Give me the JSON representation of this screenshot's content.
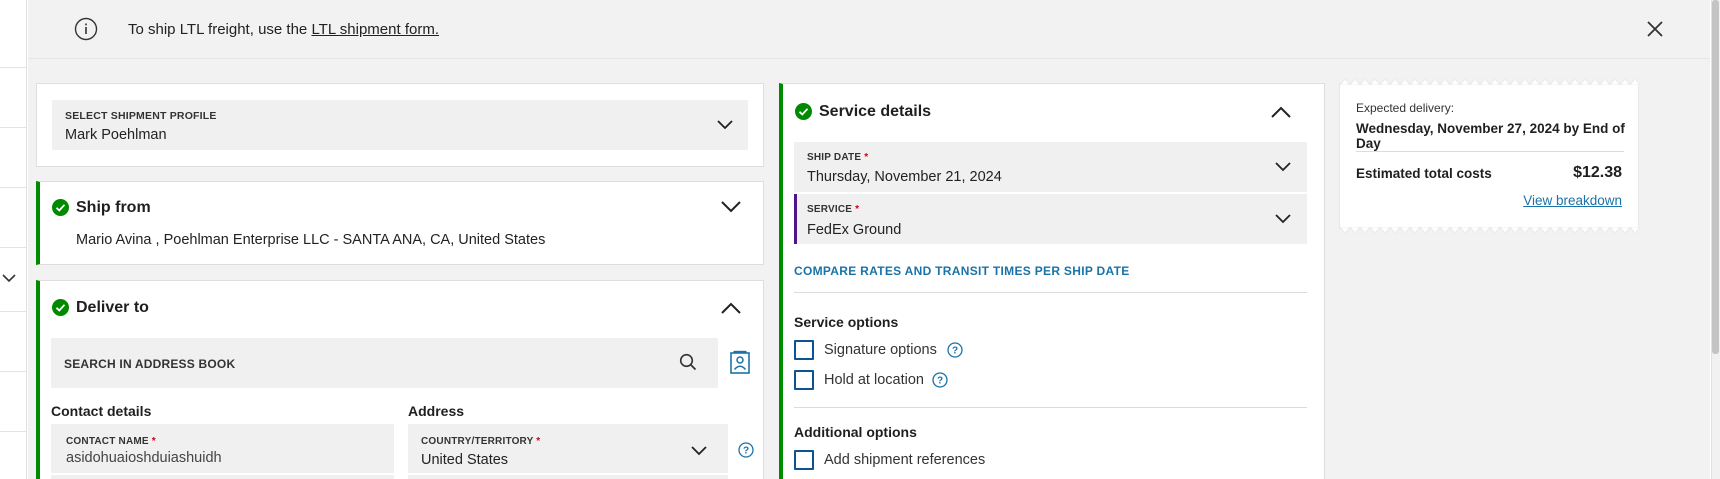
{
  "banner": {
    "message_prefix": "To ship LTL freight, use the ",
    "link_text": "LTL shipment form."
  },
  "profile": {
    "label": "SELECT SHIPMENT PROFILE",
    "value": "Mark Poehlman"
  },
  "ship_from": {
    "title": "Ship from",
    "address": "Mario Avina , Poehlman Enterprise LLC - SANTA ANA, CA, United States"
  },
  "deliver_to": {
    "title": "Deliver to",
    "search_placeholder": "SEARCH IN ADDRESS BOOK",
    "contact_heading": "Contact details",
    "address_heading": "Address",
    "contact_name_label": "CONTACT NAME",
    "contact_name_value": "asidohuaioshduiashuidh",
    "country_label": "COUNTRY/TERRITORY",
    "country_value": "United States",
    "required_mark": "*"
  },
  "service_details": {
    "title": "Service details",
    "ship_date_label": "SHIP DATE",
    "ship_date_value": "Thursday, November 21, 2024",
    "service_label": "SERVICE",
    "service_value": "FedEx Ground",
    "compare_link": "COMPARE RATES AND TRANSIT TIMES PER SHIP DATE",
    "service_options_heading": "Service options",
    "options": [
      "Signature options",
      "Hold at location"
    ],
    "additional_heading": "Additional options",
    "additional_options": [
      "Add shipment references"
    ]
  },
  "summary": {
    "expected_label": "Expected delivery:",
    "expected_value": "Wednesday, November 27, 2024 by End of Day",
    "total_label": "Estimated total costs",
    "total_value": "$12.38",
    "breakdown_link": "View breakdown"
  },
  "colors": {
    "accent_green": "#008a00",
    "link_blue": "#1a73a8",
    "focus_purple": "#4d148c",
    "required_red": "#d0021b"
  }
}
